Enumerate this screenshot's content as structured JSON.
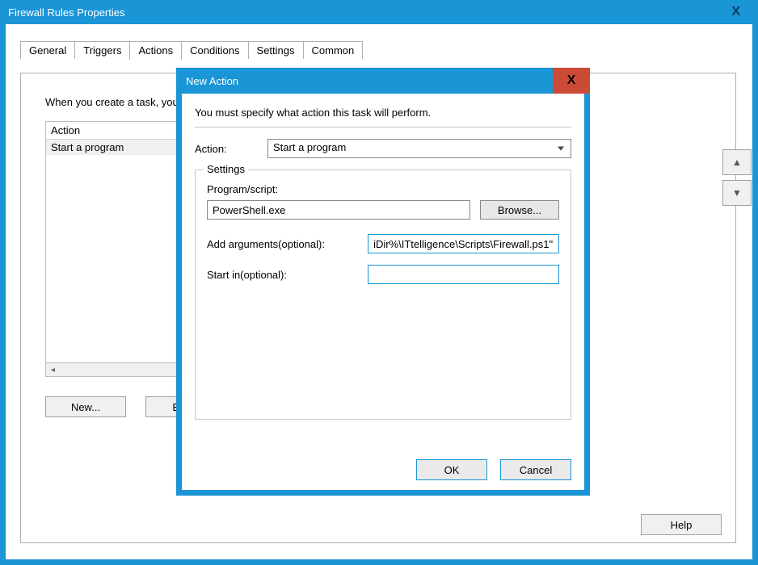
{
  "outer": {
    "title": "Firewall Rules Properties",
    "close_glyph": "X"
  },
  "tabs": {
    "general": "General",
    "triggers": "Triggers",
    "actions": "Actions",
    "conditions": "Conditions",
    "settings": "Settings",
    "common": "Common",
    "active": "actions"
  },
  "actions_panel": {
    "intro": "When you create a task, you must specify the action that will occur when your task starts.",
    "column_header": "Action",
    "rows": [
      {
        "label": "Start a program",
        "selected": true
      }
    ],
    "buttons": {
      "new": "New...",
      "edit": "Edit...",
      "help": "Help"
    }
  },
  "dialog": {
    "title": "New Action",
    "close_glyph": "X",
    "intro": "You must specify what action this task will perform.",
    "action_label": "Action:",
    "action_value": "Start a program",
    "settings_legend": "Settings",
    "program_label": "Program/script:",
    "program_value": "PowerShell.exe",
    "browse_label": "Browse...",
    "args_label": "Add arguments(optional):",
    "args_value": "iDir%\\ITtelligence\\Scripts\\Firewall.ps1\"",
    "startin_label": "Start in(optional):",
    "startin_value": "",
    "ok": "OK",
    "cancel": "Cancel"
  }
}
